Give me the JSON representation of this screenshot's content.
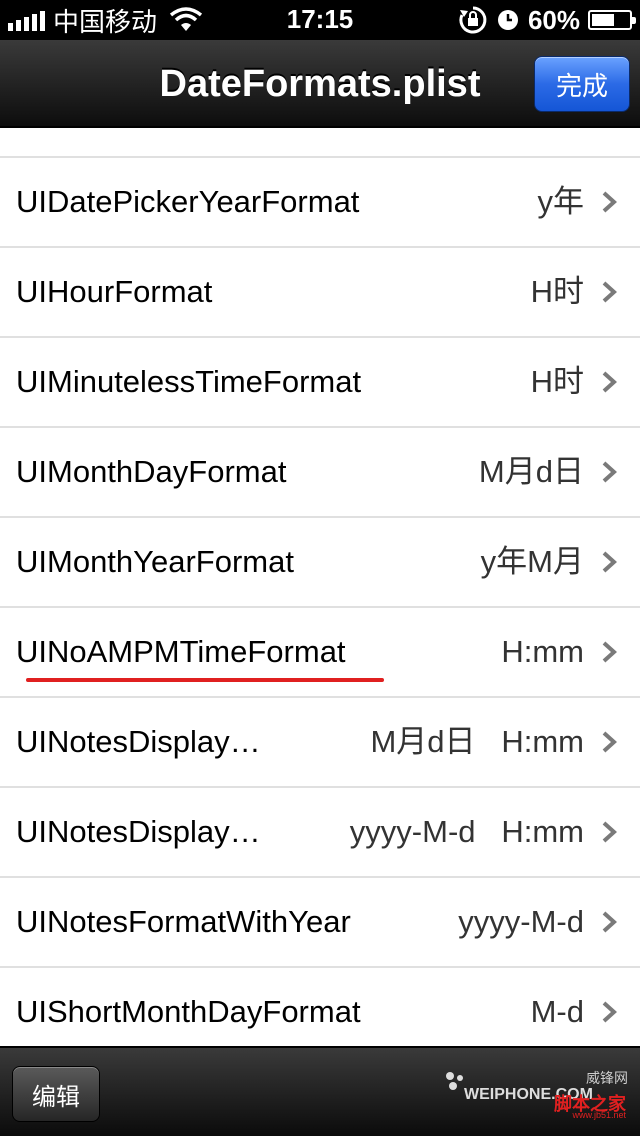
{
  "status_bar": {
    "carrier": "中国移动",
    "time": "17:15",
    "battery": "60%",
    "battery_level": 0.6,
    "icons": [
      "signal-icon",
      "wifi-icon",
      "rotation-lock-icon",
      "alarm-icon",
      "battery-icon"
    ]
  },
  "nav": {
    "title": "DateFormats.plist",
    "done_label": "完成"
  },
  "rows": [
    {
      "key": "UIDatePickerYearFormat",
      "value": "y年"
    },
    {
      "key": "UIHourFormat",
      "value": "H时"
    },
    {
      "key": "UIMinutelessTimeFormat",
      "value": "H时"
    },
    {
      "key": "UIMonthDayFormat",
      "value": "M月d日"
    },
    {
      "key": "UIMonthYearFormat",
      "value": "y年M月"
    },
    {
      "key": "UINoAMPMTimeFormat",
      "value": "H:mm"
    },
    {
      "key": "UINotesDisplay…",
      "value": "M月d日   H:mm"
    },
    {
      "key": "UINotesDisplay…",
      "value": "yyyy-M-d   H:mm"
    },
    {
      "key": "UINotesFormatWithYear",
      "value": "yyyy-M-d"
    },
    {
      "key": "UIShortMonthDayFormat",
      "value": "M-d"
    }
  ],
  "toolbar": {
    "edit_label": "编辑"
  },
  "watermark": {
    "site1": "威锋网",
    "site1_brand": "WEIPHONE.COM",
    "site2": "脚本之家",
    "site2_url": "www.jb51.net"
  },
  "colors": {
    "done_button": "#2b6ae6",
    "highlight_underline": "#e02020"
  }
}
